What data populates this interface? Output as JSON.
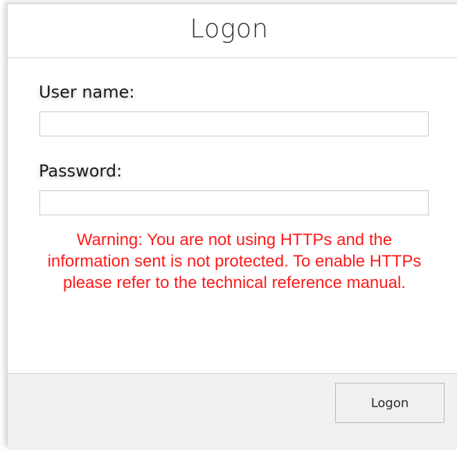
{
  "dialog": {
    "title": "Logon"
  },
  "form": {
    "username_label": "User name:",
    "username_value": "",
    "password_label": "Password:",
    "password_value": ""
  },
  "warning": {
    "text": "Warning: You are not using HTTPs and the information sent is not protected. To enable HTTPs please refer to the technical reference manual.",
    "color": "#ff1a1a"
  },
  "footer": {
    "logon_button_label": "Logon"
  }
}
